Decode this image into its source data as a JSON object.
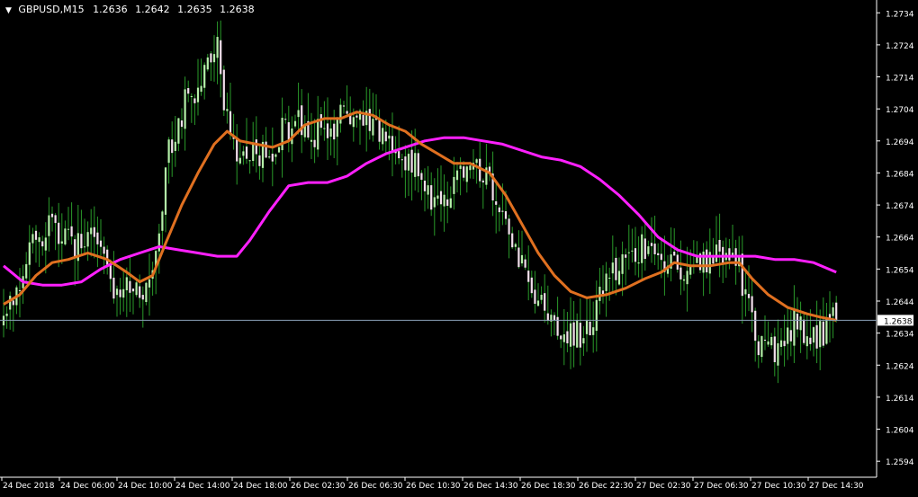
{
  "window": {
    "symbol": "GBPUSD,M15",
    "quotes": [
      "1.2636",
      "1.2642",
      "1.2635",
      "1.2638"
    ]
  },
  "colors": {
    "background": "#000000",
    "axis": "#ffffff",
    "bull_body": "#b4f0a8",
    "bear_body": "#f2e0ec",
    "wick": "#2a9a2a",
    "ma_fast": "#e07020",
    "ma_slow": "#ff20ff",
    "price_line": "#8aa0b8",
    "text": "#ffffff"
  },
  "chart_data": {
    "type": "candlestick",
    "symbol": "GBPUSD",
    "timeframe": "M15",
    "current_price": 1.2638,
    "price_label": "1.2638",
    "ylim": [
      1.2589,
      1.2738
    ],
    "y_ticks": [
      "1.2734",
      "1.2724",
      "1.2714",
      "1.2704",
      "1.2694",
      "1.2684",
      "1.2674",
      "1.2664",
      "1.2654",
      "1.2644",
      "1.2634",
      "1.2624",
      "1.2614",
      "1.2604",
      "1.2594"
    ],
    "x_ticks": [
      "24 Dec 2018",
      "24 Dec 06:00",
      "24 Dec 10:00",
      "24 Dec 14:00",
      "24 Dec 18:00",
      "26 Dec 02:30",
      "26 Dec 06:30",
      "26 Dec 10:30",
      "26 Dec 14:30",
      "26 Dec 18:30",
      "26 Dec 22:30",
      "27 Dec 02:30",
      "27 Dec 06:30",
      "27 Dec 10:30",
      "27 Dec 14:30"
    ],
    "anchors": [
      [
        0,
        1.2643
      ],
      [
        3,
        1.2645
      ],
      [
        6,
        1.2652
      ],
      [
        9,
        1.266
      ],
      [
        12,
        1.2666
      ],
      [
        15,
        1.2668
      ],
      [
        18,
        1.2665
      ],
      [
        21,
        1.266
      ],
      [
        24,
        1.2662
      ],
      [
        27,
        1.2664
      ],
      [
        30,
        1.266
      ],
      [
        33,
        1.2648
      ],
      [
        36,
        1.2646
      ],
      [
        39,
        1.265
      ],
      [
        42,
        1.2646
      ],
      [
        45,
        1.2649
      ],
      [
        48,
        1.267
      ],
      [
        51,
        1.269
      ],
      [
        54,
        1.27
      ],
      [
        57,
        1.2708
      ],
      [
        60,
        1.2712
      ],
      [
        63,
        1.2718
      ],
      [
        66,
        1.2722
      ],
      [
        69,
        1.27
      ],
      [
        71,
        1.2692
      ],
      [
        74,
        1.269
      ],
      [
        77,
        1.2692
      ],
      [
        80,
        1.269
      ],
      [
        83,
        1.2692
      ],
      [
        86,
        1.2697
      ],
      [
        89,
        1.27
      ],
      [
        92,
        1.2698
      ],
      [
        95,
        1.2695
      ],
      [
        98,
        1.2697
      ],
      [
        101,
        1.2697
      ],
      [
        104,
        1.2702
      ],
      [
        107,
        1.2703
      ],
      [
        110,
        1.27
      ],
      [
        113,
        1.2698
      ],
      [
        116,
        1.2695
      ],
      [
        119,
        1.2692
      ],
      [
        122,
        1.269
      ],
      [
        125,
        1.2688
      ],
      [
        128,
        1.2685
      ],
      [
        131,
        1.268
      ],
      [
        134,
        1.2672
      ],
      [
        137,
        1.2675
      ],
      [
        140,
        1.2685
      ],
      [
        143,
        1.2688
      ],
      [
        146,
        1.2685
      ],
      [
        149,
        1.2682
      ],
      [
        152,
        1.2675
      ],
      [
        155,
        1.2668
      ],
      [
        158,
        1.266
      ],
      [
        161,
        1.2652
      ],
      [
        164,
        1.2646
      ],
      [
        167,
        1.2642
      ],
      [
        170,
        1.2638
      ],
      [
        173,
        1.2636
      ],
      [
        176,
        1.2634
      ],
      [
        179,
        1.2632
      ],
      [
        182,
        1.264
      ],
      [
        185,
        1.265
      ],
      [
        188,
        1.2654
      ],
      [
        191,
        1.2656
      ],
      [
        194,
        1.2658
      ],
      [
        197,
        1.266
      ],
      [
        200,
        1.2662
      ],
      [
        203,
        1.2657
      ],
      [
        206,
        1.2654
      ],
      [
        209,
        1.2655
      ],
      [
        212,
        1.2656
      ],
      [
        215,
        1.2657
      ],
      [
        218,
        1.2658
      ],
      [
        221,
        1.266
      ],
      [
        224,
        1.266
      ],
      [
        227,
        1.2655
      ],
      [
        230,
        1.264
      ],
      [
        233,
        1.2632
      ],
      [
        236,
        1.263
      ],
      [
        239,
        1.2628
      ],
      [
        242,
        1.2634
      ],
      [
        245,
        1.2638
      ],
      [
        248,
        1.263
      ],
      [
        251,
        1.2632
      ],
      [
        254,
        1.2636
      ],
      [
        257,
        1.2638
      ]
    ],
    "ma_fast_values": [
      [
        0,
        1.2643
      ],
      [
        5,
        1.2646
      ],
      [
        10,
        1.2652
      ],
      [
        15,
        1.2656
      ],
      [
        20,
        1.2657
      ],
      [
        26,
        1.2659
      ],
      [
        32,
        1.2657
      ],
      [
        38,
        1.2653
      ],
      [
        42,
        1.265
      ],
      [
        46,
        1.2652
      ],
      [
        50,
        1.2662
      ],
      [
        55,
        1.2674
      ],
      [
        60,
        1.2684
      ],
      [
        65,
        1.2693
      ],
      [
        69,
        1.2697
      ],
      [
        73,
        1.2694
      ],
      [
        78,
        1.2693
      ],
      [
        83,
        1.2692
      ],
      [
        88,
        1.2694
      ],
      [
        93,
        1.2699
      ],
      [
        99,
        1.2701
      ],
      [
        104,
        1.2701
      ],
      [
        109,
        1.2703
      ],
      [
        114,
        1.2702
      ],
      [
        119,
        1.2699
      ],
      [
        124,
        1.2697
      ],
      [
        129,
        1.2693
      ],
      [
        134,
        1.269
      ],
      [
        139,
        1.2687
      ],
      [
        144,
        1.2687
      ],
      [
        150,
        1.2684
      ],
      [
        155,
        1.2677
      ],
      [
        160,
        1.2668
      ],
      [
        165,
        1.2659
      ],
      [
        170,
        1.2652
      ],
      [
        175,
        1.2647
      ],
      [
        180,
        1.2645
      ],
      [
        186,
        1.2646
      ],
      [
        192,
        1.2648
      ],
      [
        198,
        1.2651
      ],
      [
        203,
        1.2653
      ],
      [
        207,
        1.2656
      ],
      [
        212,
        1.2655
      ],
      [
        218,
        1.2655
      ],
      [
        224,
        1.2656
      ],
      [
        227,
        1.2656
      ],
      [
        231,
        1.2651
      ],
      [
        236,
        1.2646
      ],
      [
        242,
        1.2642
      ],
      [
        248,
        1.264
      ],
      [
        252,
        1.2639
      ],
      [
        257,
        1.2638
      ]
    ],
    "ma_slow_values": [
      [
        0,
        1.2655
      ],
      [
        6,
        1.265
      ],
      [
        12,
        1.2649
      ],
      [
        18,
        1.2649
      ],
      [
        24,
        1.265
      ],
      [
        30,
        1.2654
      ],
      [
        36,
        1.2657
      ],
      [
        42,
        1.2659
      ],
      [
        48,
        1.2661
      ],
      [
        54,
        1.266
      ],
      [
        60,
        1.2659
      ],
      [
        66,
        1.2658
      ],
      [
        72,
        1.2658
      ],
      [
        76,
        1.2663
      ],
      [
        82,
        1.2672
      ],
      [
        88,
        1.268
      ],
      [
        94,
        1.2681
      ],
      [
        100,
        1.2681
      ],
      [
        106,
        1.2683
      ],
      [
        112,
        1.2687
      ],
      [
        118,
        1.269
      ],
      [
        124,
        1.2692
      ],
      [
        130,
        1.2694
      ],
      [
        136,
        1.2695
      ],
      [
        142,
        1.2695
      ],
      [
        148,
        1.2694
      ],
      [
        154,
        1.2693
      ],
      [
        160,
        1.2691
      ],
      [
        166,
        1.2689
      ],
      [
        172,
        1.2688
      ],
      [
        178,
        1.2686
      ],
      [
        184,
        1.2682
      ],
      [
        190,
        1.2677
      ],
      [
        196,
        1.2671
      ],
      [
        202,
        1.2664
      ],
      [
        208,
        1.266
      ],
      [
        214,
        1.2658
      ],
      [
        220,
        1.2658
      ],
      [
        226,
        1.2658
      ],
      [
        232,
        1.2658
      ],
      [
        238,
        1.2657
      ],
      [
        244,
        1.2657
      ],
      [
        250,
        1.2656
      ],
      [
        257,
        1.2653
      ]
    ]
  }
}
